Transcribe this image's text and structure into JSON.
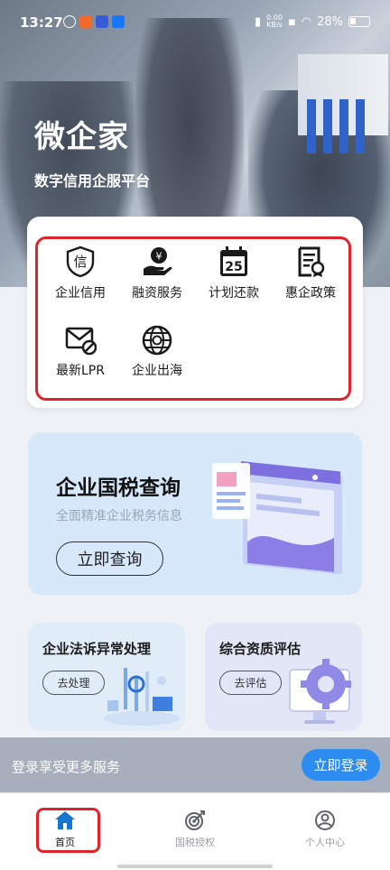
{
  "status_bar": {
    "time": "13:27",
    "net_speed_value": "0.00",
    "net_speed_unit": "KB/s",
    "battery": "28%"
  },
  "hero": {
    "title": "微企家",
    "subtitle": "数字信用企服平台"
  },
  "services": [
    {
      "label": "企业信用",
      "icon": "shield-credit-icon"
    },
    {
      "label": "融资服务",
      "icon": "hand-yuan-icon"
    },
    {
      "label": "计划还款",
      "icon": "calendar-25-icon",
      "icon_text": "25"
    },
    {
      "label": "惠企政策",
      "icon": "policy-doc-icon"
    },
    {
      "label": "最新LPR",
      "icon": "mail-blocked-icon"
    },
    {
      "label": "企业出海",
      "icon": "globe-icon"
    }
  ],
  "tax_banner": {
    "title": "企业国税查询",
    "subtitle": "全面精准企业税务信息",
    "button": "立即查询"
  },
  "cards": [
    {
      "title": "企业法诉异常处理",
      "button": "去处理"
    },
    {
      "title": "综合资质评估",
      "button": "去评估"
    }
  ],
  "login_bar": {
    "text": "登录享受更多服务",
    "button": "立即登录"
  },
  "nav": [
    {
      "label": "首页",
      "icon": "home-icon",
      "active": true
    },
    {
      "label": "国税授权",
      "icon": "target-icon",
      "active": false
    },
    {
      "label": "个人中心",
      "icon": "user-icon",
      "active": false
    }
  ],
  "colors": {
    "accent": "#2d8cf0",
    "highlight_red": "#e0232b",
    "nav_active": "#1677d2",
    "nav_inactive": "#9aa0a6"
  }
}
